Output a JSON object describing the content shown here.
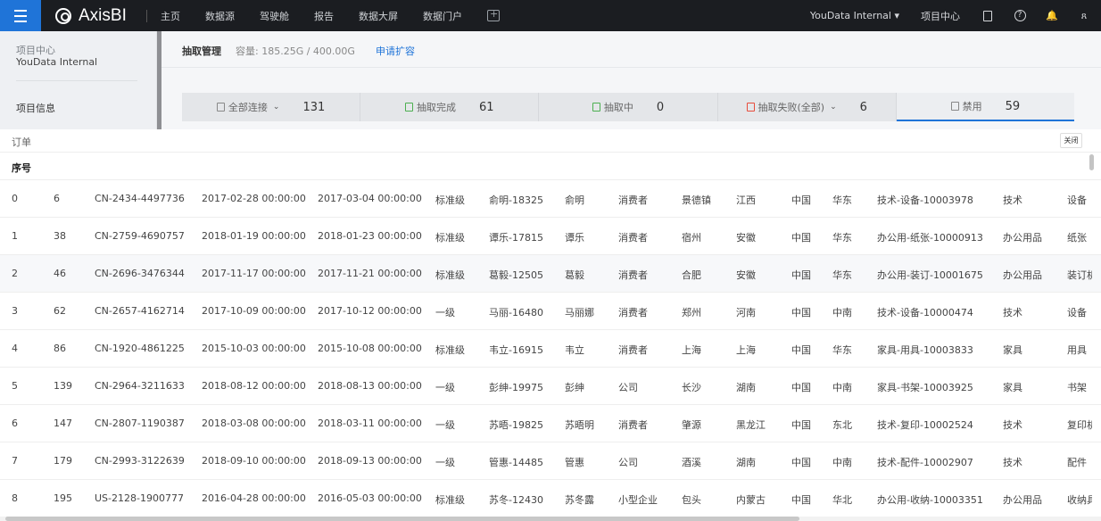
{
  "topbar": {
    "app_name": "AxisBI",
    "nav": [
      "主页",
      "数据源",
      "驾驶舱",
      "报告",
      "数据大屏",
      "数据门户"
    ],
    "user": "YouData Internal ▾",
    "project_center": "项目中心",
    "help_glyph": "?",
    "bell_glyph": "🔔",
    "user_glyph": "ጸ"
  },
  "sidebar": {
    "label": "项目中心",
    "name": "YouData Internal",
    "info": "项目信息"
  },
  "header": {
    "title": "抽取管理",
    "capacity": "容量: 185.25G / 400.00G",
    "apply": "申请扩容"
  },
  "stats": [
    {
      "label": "全部连接",
      "value": "131",
      "chevron": "⌄"
    },
    {
      "label": "抽取完成",
      "value": "61"
    },
    {
      "label": "抽取中",
      "value": "0"
    },
    {
      "label": "抽取失败(全部)",
      "value": "6",
      "chevron": "⌄"
    },
    {
      "label": "禁用",
      "value": "59"
    }
  ],
  "panel": {
    "title": "订单",
    "close": "关闭",
    "column": "序号"
  },
  "rows": [
    [
      "0",
      "6",
      "CN-2434-4497736",
      "2017-02-28 00:00:00",
      "2017-03-04 00:00:00",
      "标准级",
      "俞明-18325",
      "俞明",
      "消费者",
      "景德镇",
      "江西",
      "中国",
      "华东",
      "技术-设备-10003978",
      "技术",
      "设备"
    ],
    [
      "1",
      "38",
      "CN-2759-4690757",
      "2018-01-19 00:00:00",
      "2018-01-23 00:00:00",
      "标准级",
      "谭乐-17815",
      "谭乐",
      "消费者",
      "宿州",
      "安徽",
      "中国",
      "华东",
      "办公用-纸张-10000913",
      "办公用品",
      "纸张"
    ],
    [
      "2",
      "46",
      "CN-2696-3476344",
      "2017-11-17 00:00:00",
      "2017-11-21 00:00:00",
      "标准级",
      "葛毅-12505",
      "葛毅",
      "消费者",
      "合肥",
      "安徽",
      "中国",
      "华东",
      "办公用-装订-10001675",
      "办公用品",
      "装订机"
    ],
    [
      "3",
      "62",
      "CN-2657-4162714",
      "2017-10-09 00:00:00",
      "2017-10-12 00:00:00",
      "一级",
      "马丽-16480",
      "马丽娜",
      "消费者",
      "郑州",
      "河南",
      "中国",
      "中南",
      "技术-设备-10000474",
      "技术",
      "设备"
    ],
    [
      "4",
      "86",
      "CN-1920-4861225",
      "2015-10-03 00:00:00",
      "2015-10-08 00:00:00",
      "标准级",
      "韦立-16915",
      "韦立",
      "消费者",
      "上海",
      "上海",
      "中国",
      "华东",
      "家具-用具-10003833",
      "家具",
      "用具"
    ],
    [
      "5",
      "139",
      "CN-2964-3211633",
      "2018-08-12 00:00:00",
      "2018-08-13 00:00:00",
      "一级",
      "彭绅-19975",
      "彭绅",
      "公司",
      "长沙",
      "湖南",
      "中国",
      "中南",
      "家具-书架-10003925",
      "家具",
      "书架"
    ],
    [
      "6",
      "147",
      "CN-2807-1190387",
      "2018-03-08 00:00:00",
      "2018-03-11 00:00:00",
      "一级",
      "苏晤-19825",
      "苏晤明",
      "消费者",
      "肇源",
      "黑龙江",
      "中国",
      "东北",
      "技术-复印-10002524",
      "技术",
      "复印机"
    ],
    [
      "7",
      "179",
      "CN-2993-3122639",
      "2018-09-10 00:00:00",
      "2018-09-13 00:00:00",
      "一级",
      "管惠-14485",
      "管惠",
      "公司",
      "酒溪",
      "湖南",
      "中国",
      "中南",
      "技术-配件-10002907",
      "技术",
      "配件"
    ],
    [
      "8",
      "195",
      "US-2128-1900777",
      "2016-04-28 00:00:00",
      "2016-05-03 00:00:00",
      "标准级",
      "苏冬-12430",
      "苏冬露",
      "小型企业",
      "包头",
      "内蒙古",
      "中国",
      "华北",
      "办公用-收纳-10003351",
      "办公用品",
      "收纳具"
    ]
  ]
}
